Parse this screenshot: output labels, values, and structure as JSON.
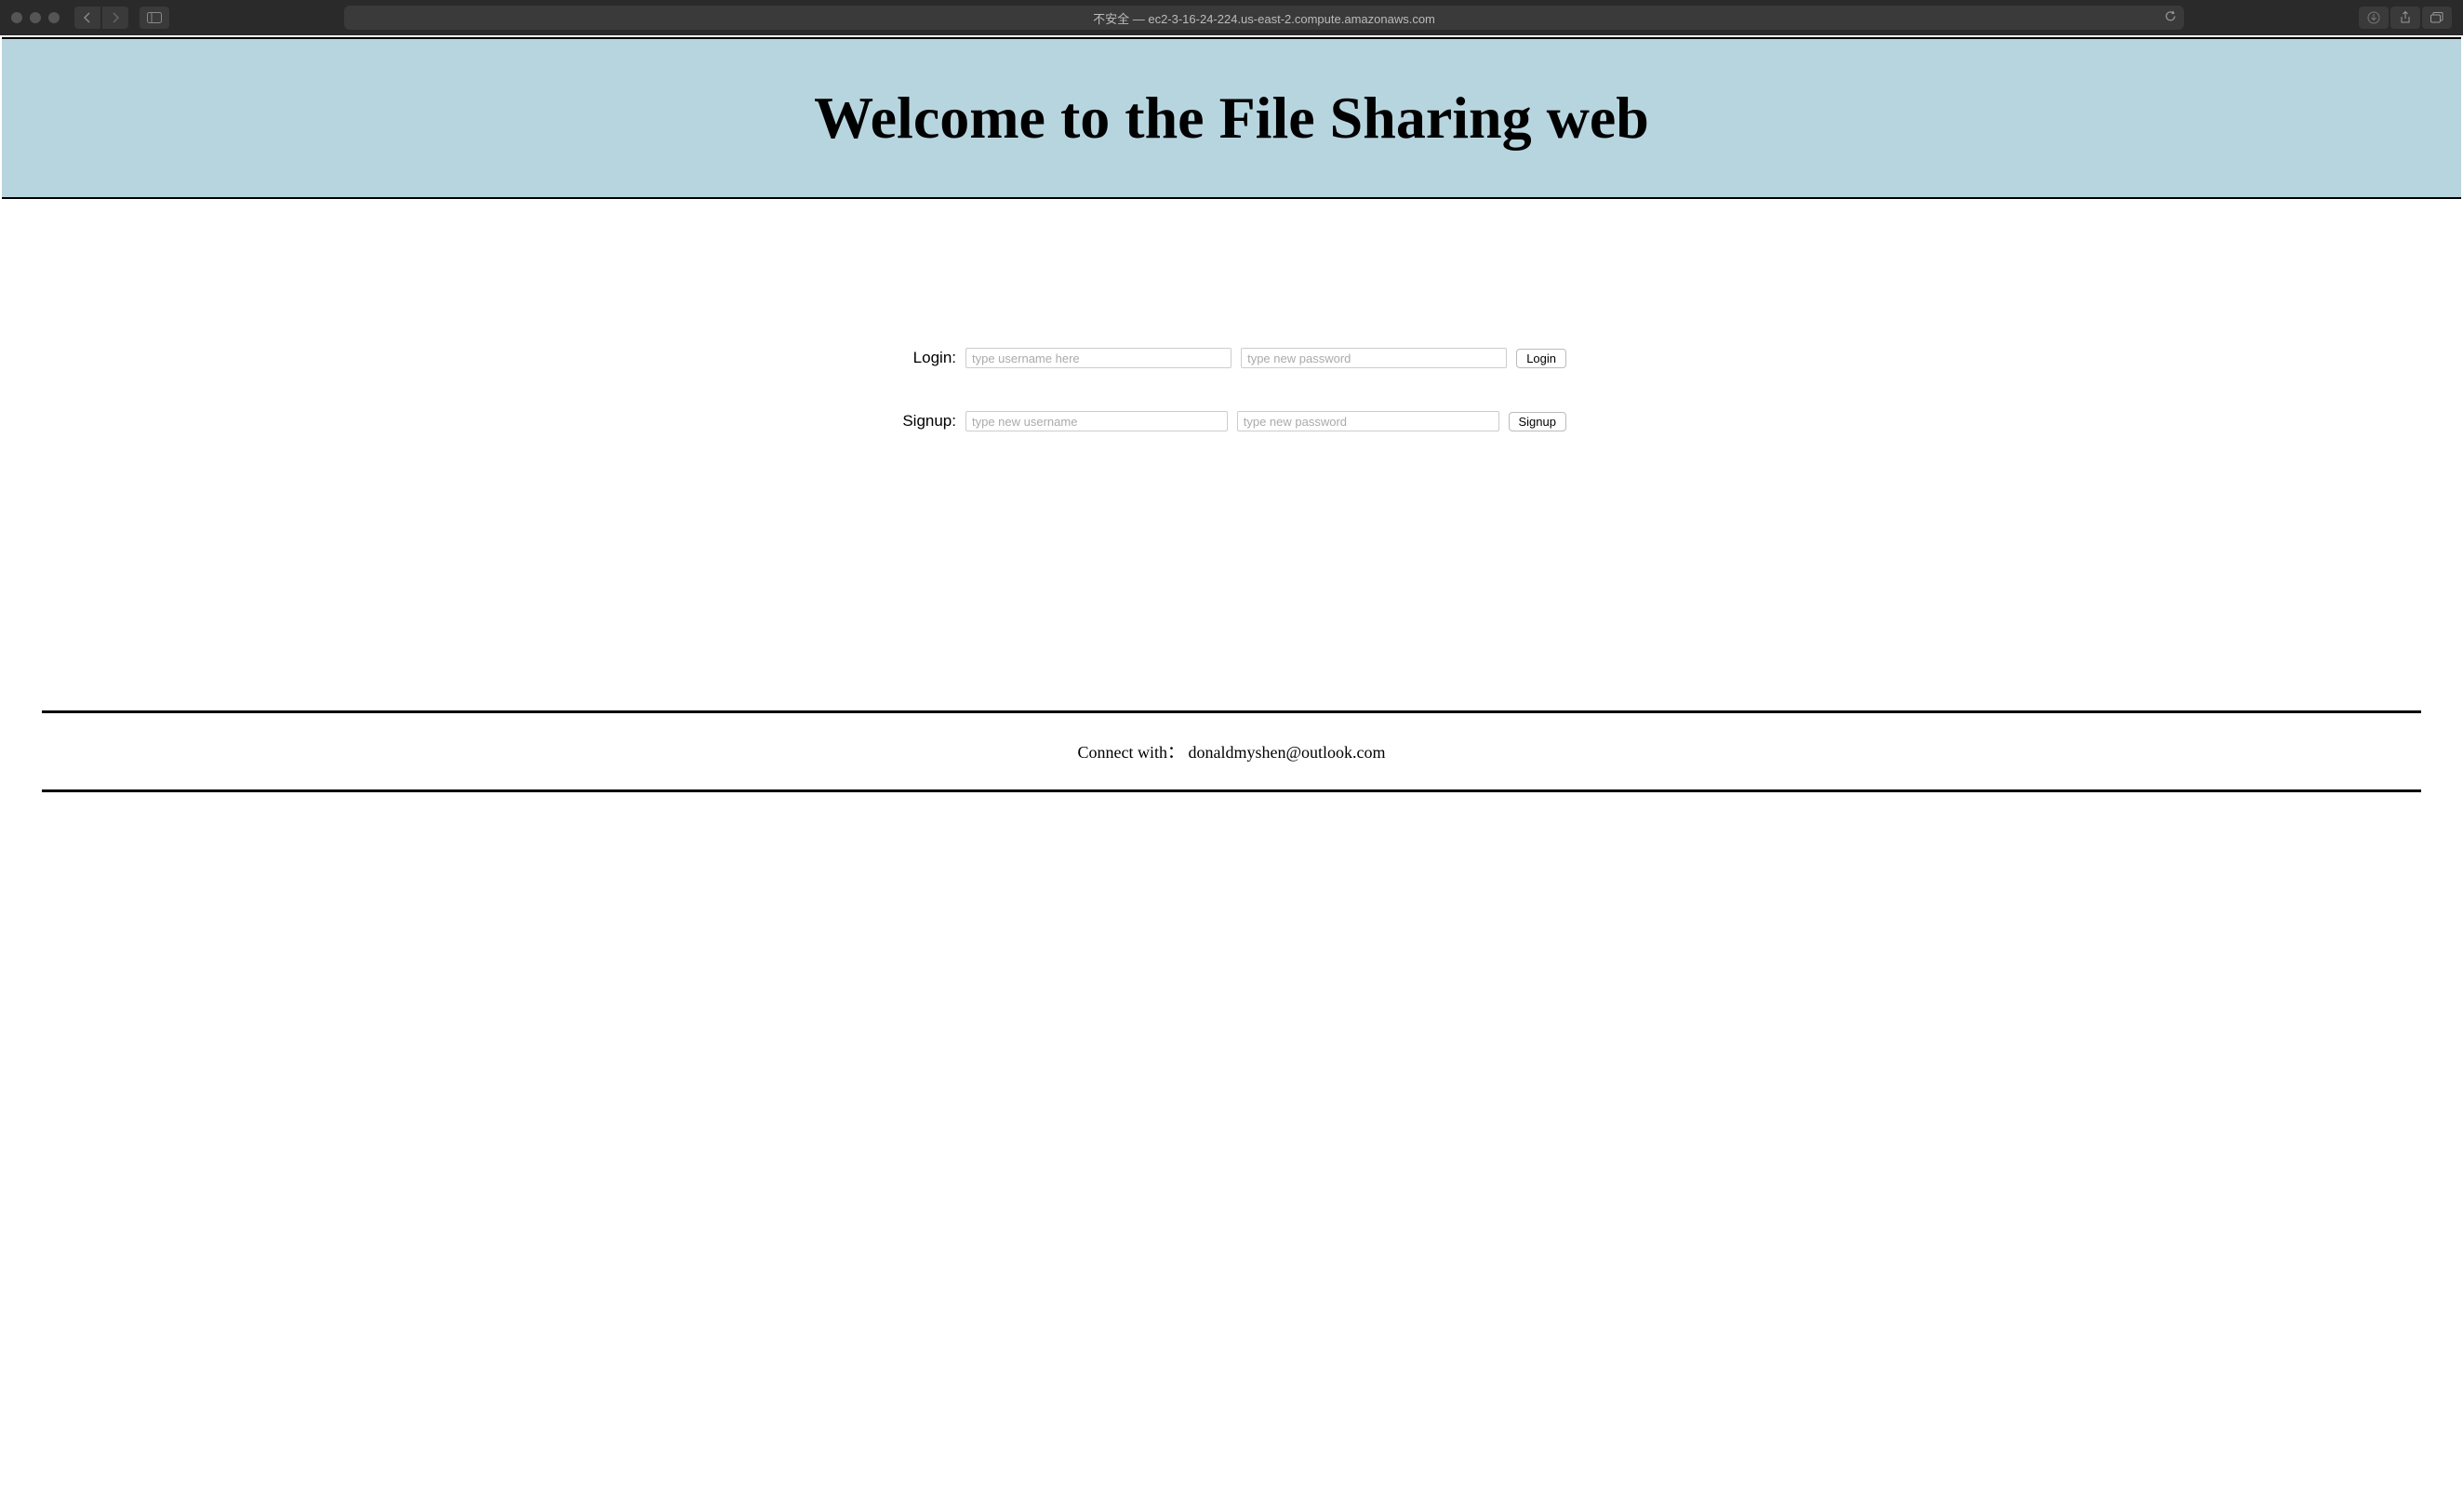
{
  "browser": {
    "url_display": "不安全 — ec2-3-16-24-224.us-east-2.compute.amazonaws.com"
  },
  "page": {
    "header_title": "Welcome to the File Sharing web",
    "login": {
      "label": "Login:",
      "username_placeholder": "type username here",
      "password_placeholder": "type new password",
      "button": "Login"
    },
    "signup": {
      "label": "Signup:",
      "username_placeholder": "type new username",
      "password_placeholder": "type new password",
      "button": "Signup"
    },
    "footer": {
      "contact_label": "Connect with：",
      "contact_email": "donaldmyshen@outlook.com"
    }
  }
}
